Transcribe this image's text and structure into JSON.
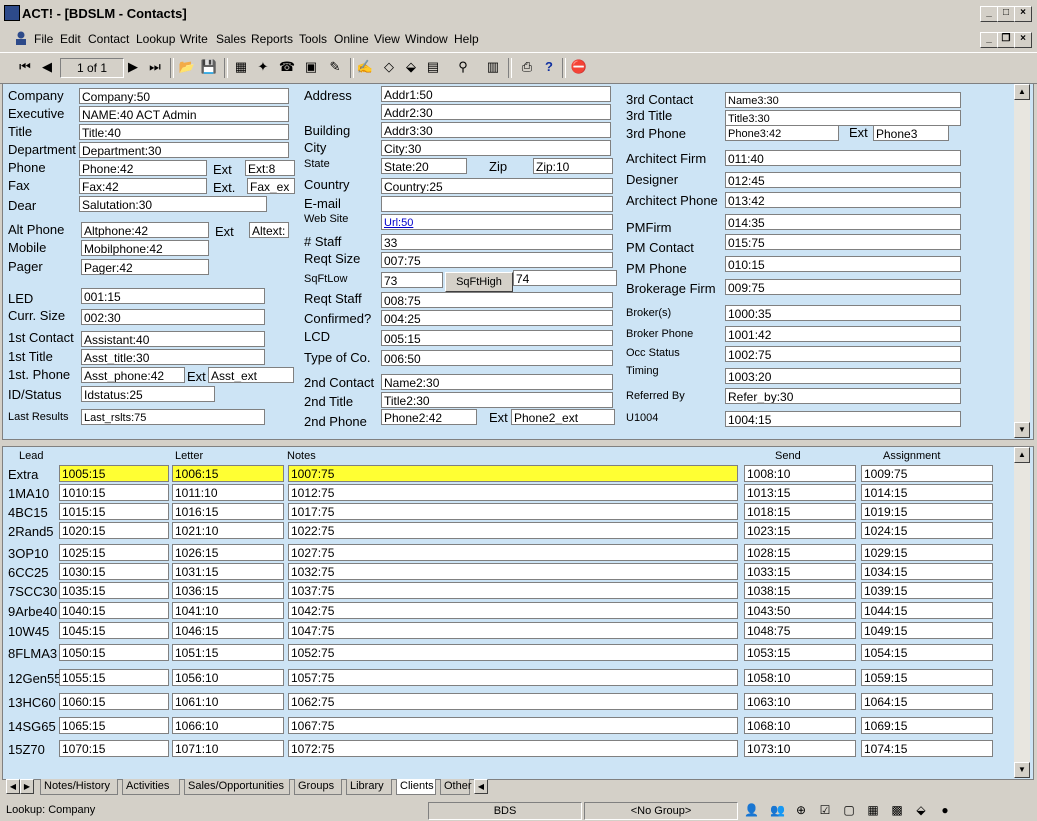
{
  "window": {
    "title": "ACT! - [BDSLM - Contacts]"
  },
  "menus": [
    "File",
    "Edit",
    "Contact",
    "Lookup",
    "Write",
    "Sales",
    "Reports",
    "Tools",
    "Online",
    "View",
    "Window",
    "Help"
  ],
  "toolbar": {
    "record_position": "1 of 1"
  },
  "contact": {
    "left": [
      {
        "label": "Company",
        "value": "Company:50"
      },
      {
        "label": "Executive",
        "value": "NAME:40  ACT Admin"
      },
      {
        "label": "Title",
        "value": "Title:40"
      },
      {
        "label": "Department",
        "value": "Department:30"
      },
      {
        "label": "Phone",
        "value": "Phone:42",
        "ext_label": "Ext",
        "ext_value": "Ext:8"
      },
      {
        "label": "Fax",
        "value": "Fax:42",
        "ext_label": "Ext.",
        "ext_value": "Fax_ex"
      },
      {
        "label": "Dear",
        "value": "Salutation:30"
      },
      {
        "label": "Alt Phone",
        "value": "Altphone:42",
        "ext_label": "Ext",
        "ext_value": "Altext:"
      },
      {
        "label": "Mobile",
        "value": "Mobilphone:42"
      },
      {
        "label": "Pager",
        "value": "Pager:42"
      },
      {
        "label": "LED",
        "value": "001:15"
      },
      {
        "label": "Curr. Size",
        "value": "002:30"
      },
      {
        "label": "1st Contact",
        "value": "Assistant:40"
      },
      {
        "label": "1st Title",
        "value": "Asst_title:30"
      },
      {
        "label": "1st. Phone",
        "value": "Asst_phone:42",
        "ext_label": "Ext",
        "ext_value": "Asst_ext"
      },
      {
        "label": "ID/Status",
        "value": "Idstatus:25"
      },
      {
        "label": "Last Results",
        "value": "Last_rslts:75"
      }
    ],
    "middle": [
      {
        "label": "Address",
        "value": "Addr1:50"
      },
      {
        "label": "",
        "value": "Addr2:30"
      },
      {
        "label": "Building",
        "value": "Addr3:30"
      },
      {
        "label": "City",
        "value": "City:30"
      },
      {
        "label": "State",
        "value": "State:20",
        "zip_label": "Zip",
        "zip_value": "Zip:10"
      },
      {
        "label": "Country",
        "value": "Country:25"
      },
      {
        "label": "E-mail",
        "value": ""
      },
      {
        "label": "Web Site",
        "value": "Url:50"
      },
      {
        "label": "# Staff",
        "value": "33"
      },
      {
        "label": "Reqt Size",
        "value": "007:75"
      },
      {
        "label": "SqFtLow",
        "value": "73",
        "high_label": "SqFtHigh",
        "high_value": "74"
      },
      {
        "label": "Reqt Staff",
        "value": "008:75"
      },
      {
        "label": "Confirmed?",
        "value": "004:25"
      },
      {
        "label": "LCD",
        "value": "005:15"
      },
      {
        "label": "Type of Co.",
        "value": "006:50"
      },
      {
        "label": "2nd Contact",
        "value": "Name2:30"
      },
      {
        "label": "2nd Title",
        "value": "Title2:30"
      },
      {
        "label": "2nd Phone",
        "value": "Phone2:42",
        "ext_label": "Ext",
        "ext_value": "Phone2_ext"
      }
    ],
    "right": [
      {
        "label": "3rd Contact",
        "value": "Name3:30"
      },
      {
        "label": "3rd Title",
        "value": "Title3:30"
      },
      {
        "label": "3rd Phone",
        "value": "Phone3:42",
        "ext_label": "Ext",
        "ext_value": "Phone3"
      },
      {
        "label": "Architect Firm",
        "value": "011:40"
      },
      {
        "label": "Designer",
        "value": "012:45"
      },
      {
        "label": "Architect Phone",
        "value": "013:42"
      },
      {
        "label": "PMFirm",
        "value": "014:35"
      },
      {
        "label": "PM Contact",
        "value": "015:75"
      },
      {
        "label": "PM Phone",
        "value": "010:15"
      },
      {
        "label": "Brokerage Firm",
        "value": "009:75"
      },
      {
        "label": "Broker(s)",
        "value": "1000:35"
      },
      {
        "label": "Broker Phone",
        "value": "1001:42"
      },
      {
        "label": "Occ Status",
        "value": "1002:75"
      },
      {
        "label": "Timing",
        "value": "1003:20"
      },
      {
        "label": "Referred By",
        "value": "Refer_by:30"
      },
      {
        "label": "U1004",
        "value": "1004:15"
      }
    ]
  },
  "grid": {
    "headers": [
      "Lead",
      "Letter",
      "Notes",
      "Send",
      "Assignment"
    ],
    "rows": [
      {
        "label": "Extra",
        "cells": [
          "1005:15",
          "1006:15",
          "1007:75",
          "1008:10",
          "1009:75"
        ]
      },
      {
        "label": "1MA10",
        "cells": [
          "1010:15",
          "1011:10",
          "1012:75",
          "1013:15",
          "1014:15"
        ]
      },
      {
        "label": "4BC15",
        "cells": [
          "1015:15",
          "1016:15",
          "1017:75",
          "1018:15",
          "1019:15"
        ]
      },
      {
        "label": "2Rand5",
        "cells": [
          "1020:15",
          "1021:10",
          "1022:75",
          "1023:15",
          "1024:15"
        ]
      },
      {
        "label": "3OP10",
        "cells": [
          "1025:15",
          "1026:15",
          "1027:75",
          "1028:15",
          "1029:15"
        ]
      },
      {
        "label": "6CC25",
        "cells": [
          "1030:15",
          "1031:15",
          "1032:75",
          "1033:15",
          "1034:15"
        ]
      },
      {
        "label": "7SCC30",
        "cells": [
          "1035:15",
          "1036:15",
          "1037:75",
          "1038:15",
          "1039:15"
        ]
      },
      {
        "label": "9Arbe40",
        "cells": [
          "1040:15",
          "1041:10",
          "1042:75",
          "1043:50",
          "1044:15"
        ]
      },
      {
        "label": "10W45",
        "cells": [
          "1045:15",
          "1046:15",
          "1047:75",
          "1048:75",
          "1049:15"
        ]
      },
      {
        "label": "8FLMA3",
        "cells": [
          "1050:15",
          "1051:15",
          "1052:75",
          "1053:15",
          "1054:15"
        ]
      },
      {
        "label": "12Gen55",
        "cells": [
          "1055:15",
          "1056:10",
          "1057:75",
          "1058:10",
          "1059:15"
        ]
      },
      {
        "label": "13HC60",
        "cells": [
          "1060:15",
          "1061:10",
          "1062:75",
          "1063:10",
          "1064:15"
        ]
      },
      {
        "label": "14SG65",
        "cells": [
          "1065:15",
          "1066:10",
          "1067:75",
          "1068:10",
          "1069:15"
        ]
      },
      {
        "label": "15Z70",
        "cells": [
          "1070:15",
          "1071:10",
          "1072:75",
          "1073:10",
          "1074:15"
        ]
      }
    ]
  },
  "tabs": [
    "Notes/History",
    "Activities",
    "Sales/Opportunities",
    "Groups",
    "Library",
    "Clients",
    "Other"
  ],
  "active_tab": "Clients",
  "status": {
    "lookup": "Lookup: Company",
    "db": "BDS",
    "group": "<No Group>"
  },
  "colors": {
    "panel": "#cde4f5",
    "highlight": "#ffff33",
    "chrome": "#d4d0c8"
  }
}
